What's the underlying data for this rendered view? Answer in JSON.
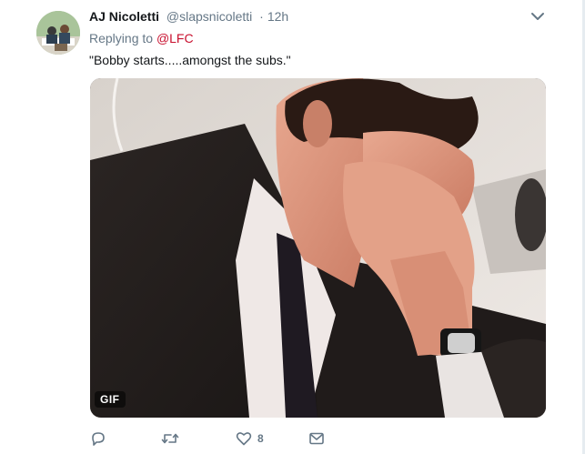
{
  "tweet": {
    "author_name": "AJ Nicoletti",
    "author_handle": "@slapsnicoletti",
    "separator": "·",
    "time": "12h",
    "replying_prefix": "Replying to ",
    "replying_mention": "@LFC",
    "text": "\"Bobby starts.....amongst the subs.\"",
    "media_badge": "GIF",
    "like_count": "8"
  },
  "icons": {
    "menu": "chevron-down-icon",
    "reply": "reply-icon",
    "retweet": "retweet-icon",
    "like": "heart-icon",
    "message": "envelope-icon"
  },
  "colors": {
    "mention": "#c8102e",
    "secondary_text": "#657786",
    "primary_text": "#14171a"
  }
}
